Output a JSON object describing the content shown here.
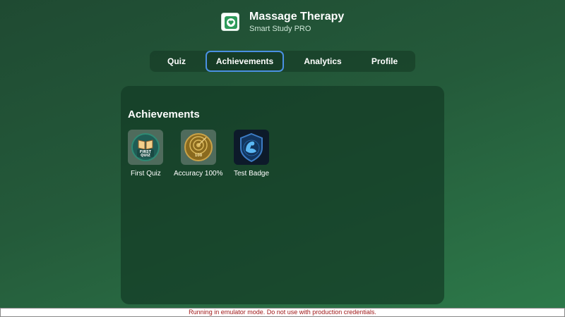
{
  "app": {
    "title": "Massage Therapy",
    "subtitle": "Smart Study PRO",
    "icon": "heart-hands-icon"
  },
  "tabs": [
    {
      "label": "Quiz",
      "active": false
    },
    {
      "label": "Achievements",
      "active": true
    },
    {
      "label": "Analytics",
      "active": false
    },
    {
      "label": "Profile",
      "active": false
    }
  ],
  "achievements": {
    "title": "Achievements",
    "badges": [
      {
        "label": "First Quiz",
        "icon": "first-quiz-book-badge",
        "badge_text": "FIRST QUIZ"
      },
      {
        "label": "Accuracy 100%",
        "icon": "accuracy-target-badge",
        "badge_text": "ACCURACY 100"
      },
      {
        "label": "Test Badge",
        "icon": "shield-arm-badge"
      }
    ]
  },
  "footer": {
    "warning": "Running in emulator mode. Do not use with production credentials."
  },
  "colors": {
    "accent": "#4a90e2",
    "background_dark": "#1f4a32",
    "background_light": "#2d7a4a",
    "warning_text": "#a01818"
  }
}
